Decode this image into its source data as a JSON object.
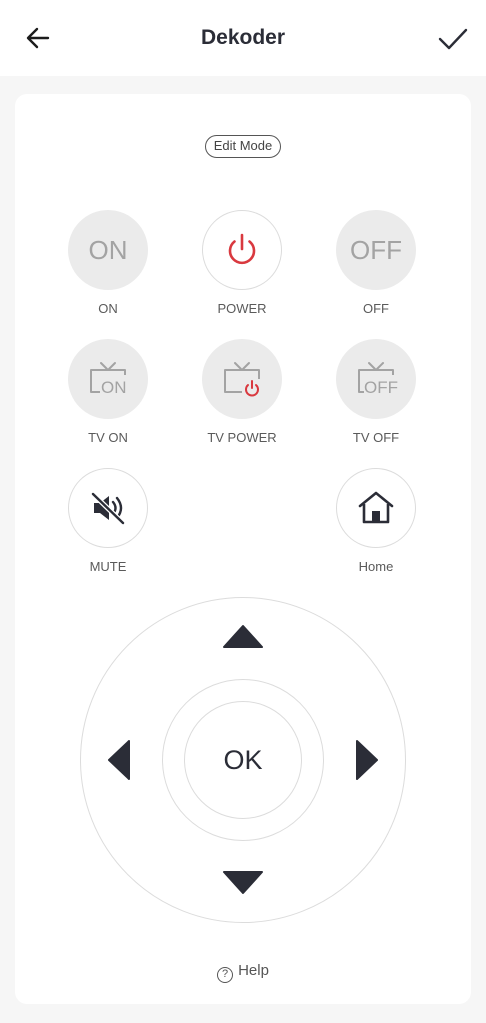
{
  "header": {
    "title": "Dekoder",
    "back_icon": "arrow-left-icon",
    "confirm_icon": "checkmark-icon"
  },
  "edit_mode": {
    "label": "Edit Mode"
  },
  "buttons": {
    "on": {
      "text": "ON",
      "label": "ON"
    },
    "power": {
      "label": "POWER",
      "icon": "power-icon",
      "color": "#d9393f"
    },
    "off": {
      "text": "OFF",
      "label": "OFF"
    },
    "tv_on": {
      "icon_text": "ON",
      "label": "TV ON"
    },
    "tv_power": {
      "label": "TV POWER"
    },
    "tv_off": {
      "icon_text": "OFF",
      "label": "TV OFF"
    },
    "mute": {
      "label": "MUTE",
      "icon": "mute-icon"
    },
    "home": {
      "label": "Home",
      "icon": "home-icon"
    }
  },
  "dpad": {
    "ok_label": "OK"
  },
  "help": {
    "icon_text": "?",
    "label": "Help"
  },
  "colors": {
    "accent_red": "#d9393f",
    "icon_dark": "#2b2d37",
    "button_fill": "#ebebeb",
    "disabled_text": "#a3a3a3"
  }
}
